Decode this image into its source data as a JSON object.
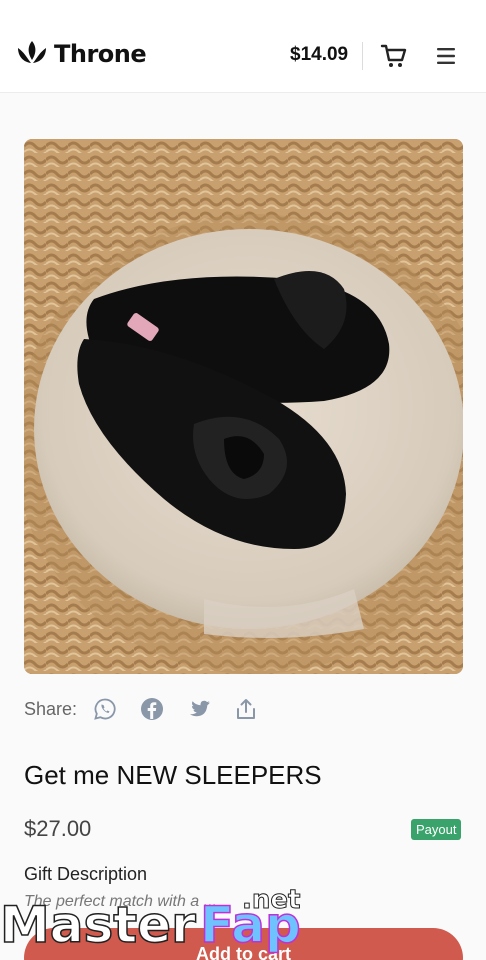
{
  "header": {
    "logo_text": "Throne",
    "balance": "$14.09",
    "cart_icon": "cart-icon",
    "menu_icon": "menu-icon"
  },
  "product": {
    "image_subject": "black knotted open-toe slippers",
    "share_label": "Share:",
    "share_icons": [
      "whatsapp-icon",
      "facebook-icon",
      "twitter-icon",
      "share-upload-icon"
    ],
    "title": "Get me NEW SLEEPERS",
    "price": "$27.00",
    "badge": "Payout",
    "gift_label": "Gift Description",
    "gift_description": "The perfect match with a ...",
    "add_button": "Add to cart"
  },
  "watermark": {
    "text": "MasterFap",
    "suffix": ".net"
  },
  "colors": {
    "accent_button": "#cf5a4d",
    "badge": "#3aa36b",
    "icon_gray": "#8a97a8"
  }
}
